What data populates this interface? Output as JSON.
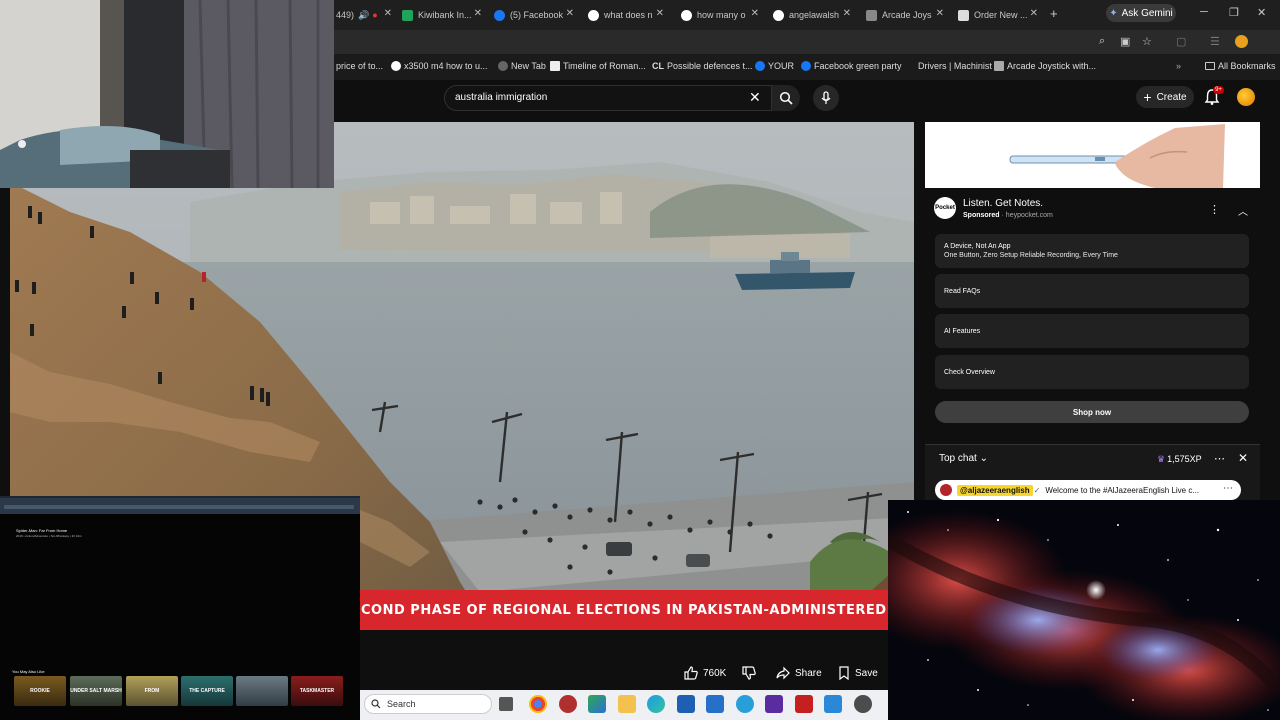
{
  "browser": {
    "tabs": [
      {
        "label": "449)",
        "icon": "speaker-icon"
      },
      {
        "label": "Kiwibank In...",
        "icon": "kiwibank-favicon"
      },
      {
        "label": "(5) Facebook",
        "icon": "facebook-favicon"
      },
      {
        "label": "what does n",
        "icon": "google-favicon"
      },
      {
        "label": "how many o",
        "icon": "google-favicon"
      },
      {
        "label": "angelawalsh",
        "icon": "google-favicon"
      },
      {
        "label": "Arcade Joys",
        "icon": "arcade-favicon"
      },
      {
        "label": "Order New ...",
        "icon": "order-favicon"
      }
    ],
    "ask_gemini": "Ask Gemini",
    "new_tab_symbol": "+",
    "bookmarks": [
      {
        "label": "price of to..."
      },
      {
        "label": "x3500 m4 how to u..."
      },
      {
        "label": "New Tab"
      },
      {
        "label": "Timeline of Roman..."
      },
      {
        "label": "Possible defences t..."
      },
      {
        "label": "YOUR"
      },
      {
        "label": "Facebook green party"
      },
      {
        "label": "Drivers | Machinist"
      },
      {
        "label": "Arcade Joystick with..."
      }
    ],
    "all_bookmarks": "All Bookmarks"
  },
  "youtube": {
    "search_value": "australia immigration",
    "create_label": "Create",
    "notification_count": "9+",
    "ticker_text": "COND PHASE OF REGIONAL ELECTIONS IN PAKISTAN-ADMINISTERED KA",
    "actions": {
      "like_count": "760K",
      "share_label": "Share",
      "save_label": "Save"
    }
  },
  "ad": {
    "logo_text": "Pocket",
    "title": "Listen. Get Notes.",
    "sponsored": "Sponsored",
    "domain": "heypocket.com",
    "rows": [
      {
        "title": "A Device, Not An App",
        "subtitle": "One Button, Zero Setup Reliable Recording, Every Time"
      },
      {
        "title": "Read FAQs",
        "subtitle": ""
      },
      {
        "title": "AI Features",
        "subtitle": ""
      },
      {
        "title": "Check Overview",
        "subtitle": ""
      }
    ],
    "cta": "Shop now"
  },
  "chat": {
    "title": "Top chat",
    "xp": "1,575XP",
    "message_handle": "@aljazeeraenglish",
    "message_text": "Welcome to the #AlJazeeraEnglish Live c..."
  },
  "mini_screen": {
    "title": "Spider-Man: Far From Home",
    "meta": "2019 • Action/Adventure • Sci-fi/Fantasy • 2h 10m",
    "you_may_like": "You May Also Like",
    "posters": [
      "ROOKIE",
      "UNDER SALT MARSH",
      "FROM",
      "THE CAPTURE",
      "",
      "TASKMASTER"
    ]
  },
  "taskbar": {
    "search_placeholder": "Search"
  }
}
